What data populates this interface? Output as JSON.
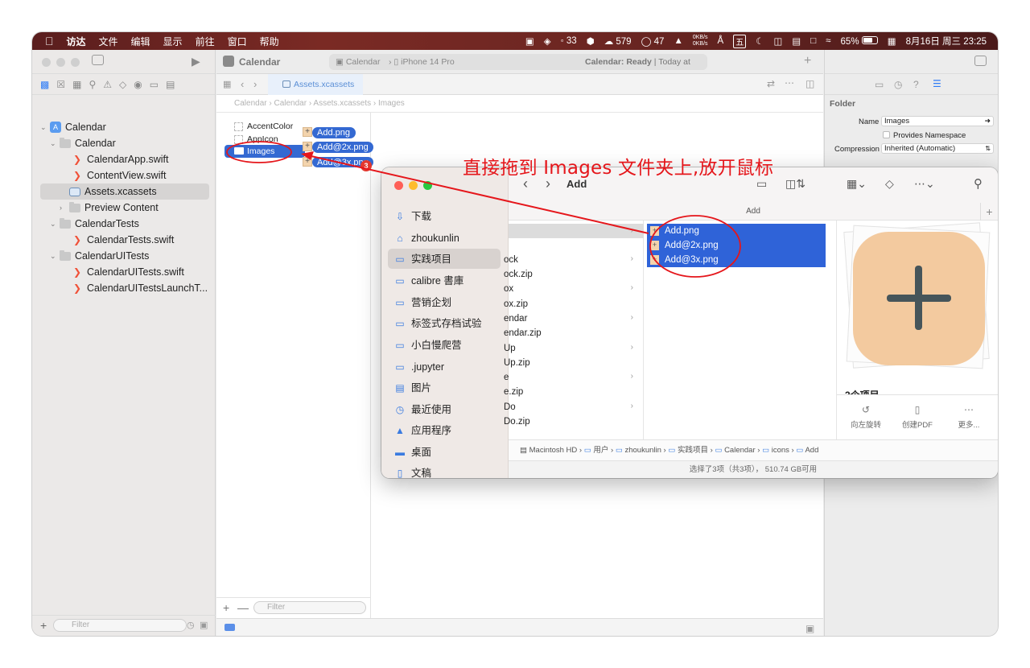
{
  "menubar": {
    "menus": [
      "访达",
      "文件",
      "编辑",
      "显示",
      "前往",
      "窗口",
      "帮助"
    ],
    "status_items": [
      "33",
      "579",
      "47"
    ],
    "net_up": "0KB/s",
    "net_down": "0KB/s",
    "input_method": "五",
    "battery": "65%",
    "datetime": "8月16日 周三  23:25"
  },
  "xcode": {
    "project_title": "Calendar",
    "scheme": "Calendar",
    "device": "iPhone 14 Pro",
    "status": "Calendar: Ready",
    "status_time": "Today at 23:24",
    "active_tab": "Assets.xcassets",
    "breadcrumb": [
      "Calendar",
      "Calendar",
      "Assets.xcassets",
      "Images"
    ],
    "navigator": [
      {
        "label": "Calendar",
        "kind": "project"
      },
      {
        "label": "Calendar",
        "kind": "folder"
      },
      {
        "label": "CalendarApp.swift",
        "kind": "swift"
      },
      {
        "label": "ContentView.swift",
        "kind": "swift"
      },
      {
        "label": "Assets.xcassets",
        "kind": "assets"
      },
      {
        "label": "Preview Content",
        "kind": "folder"
      },
      {
        "label": "CalendarTests",
        "kind": "folder"
      },
      {
        "label": "CalendarTests.swift",
        "kind": "swift"
      },
      {
        "label": "CalendarUITests",
        "kind": "folder"
      },
      {
        "label": "CalendarUITests.swift",
        "kind": "swift"
      },
      {
        "label": "CalendarUITestsLaunchT...",
        "kind": "swift"
      }
    ],
    "nav_filter_placeholder": "Filter",
    "assets": [
      "AccentColor",
      "AppIcon",
      "Images"
    ],
    "asset_filter_placeholder": "Filter",
    "drag_items": [
      "Add.png",
      "Add@2x.png",
      "Add@3x.png"
    ],
    "drag_count": "3",
    "inspector": {
      "section": "Folder",
      "name_label": "Name",
      "name_value": "Images",
      "provides_namespace": "Provides Namespace",
      "compression_label": "Compression",
      "compression_value": "Inherited (Automatic)"
    }
  },
  "annotation": "直接拖到 Images 文件夹上,放开鼠标",
  "finder": {
    "title": "Add",
    "column_header": "Add",
    "sidebar": [
      "下载",
      "zhoukunlin",
      "实践项目",
      "calibre 書庫",
      "营销企划",
      "标签式存档试验",
      "小白慢爬营",
      ".jupyter",
      "图片",
      "最近使用",
      "应用程序",
      "桌面",
      "文稿"
    ],
    "column2": [
      "ock",
      "ock.zip",
      "ox",
      "ox.zip",
      "endar",
      "endar.zip",
      "Up",
      "Up.zip",
      "e",
      "e.zip",
      "Do",
      "Do.zip"
    ],
    "files": [
      "Add.png",
      "Add@2x.png",
      "Add@3x.png"
    ],
    "preview_caption": "3个项目",
    "preview_actions": [
      "向左旋转",
      "创建PDF",
      "更多..."
    ],
    "path": [
      "Macintosh HD",
      "用户",
      "zhoukunlin",
      "实践项目",
      "Calendar",
      "icons",
      "Add"
    ],
    "status": "选择了3项（共3项）， 510.74 GB可用"
  },
  "colors": {
    "selection": "#3469d2",
    "annotation": "#e5161b",
    "preview_fill": "#f2c79a"
  }
}
